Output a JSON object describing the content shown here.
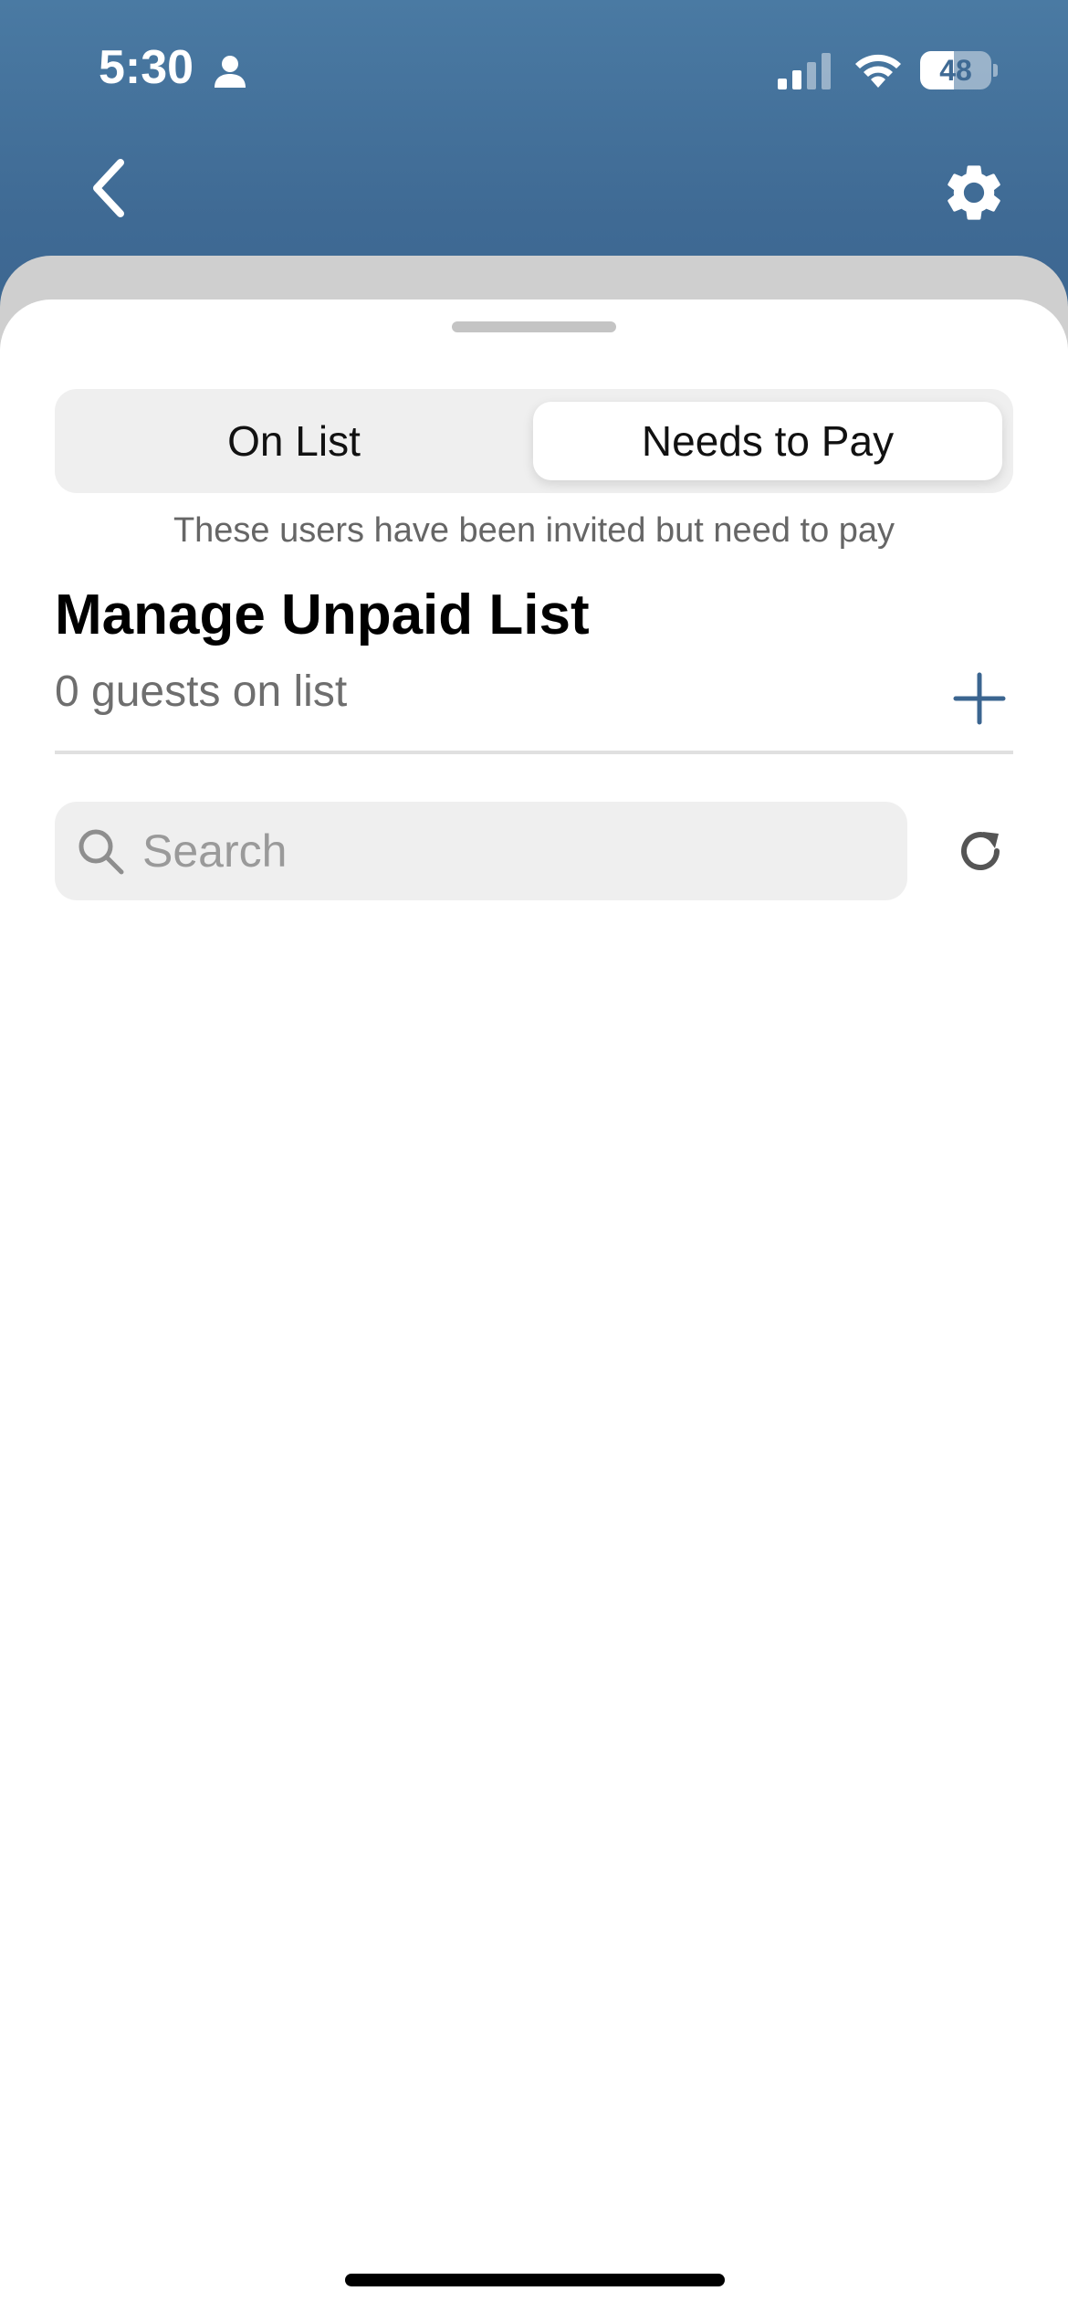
{
  "status_bar": {
    "time": "5:30",
    "battery_text": "48",
    "battery_level": 0.48
  },
  "nav": {
    "back_icon": "chevron-left-icon",
    "settings_icon": "gear-icon"
  },
  "segmented_control": {
    "tabs": [
      {
        "label": "On List",
        "selected": false
      },
      {
        "label": "Needs to Pay",
        "selected": true
      }
    ]
  },
  "info_text": "These users have been invited but need to pay",
  "list_header": {
    "title": "Manage Unpaid List",
    "guest_count": "0 guests on list"
  },
  "search": {
    "placeholder": "Search",
    "value": ""
  },
  "colors": {
    "header_blue": "#3f6a94",
    "accent": "#3b6590",
    "sheet_background": "#ffffff",
    "segment_background": "#efefef"
  }
}
